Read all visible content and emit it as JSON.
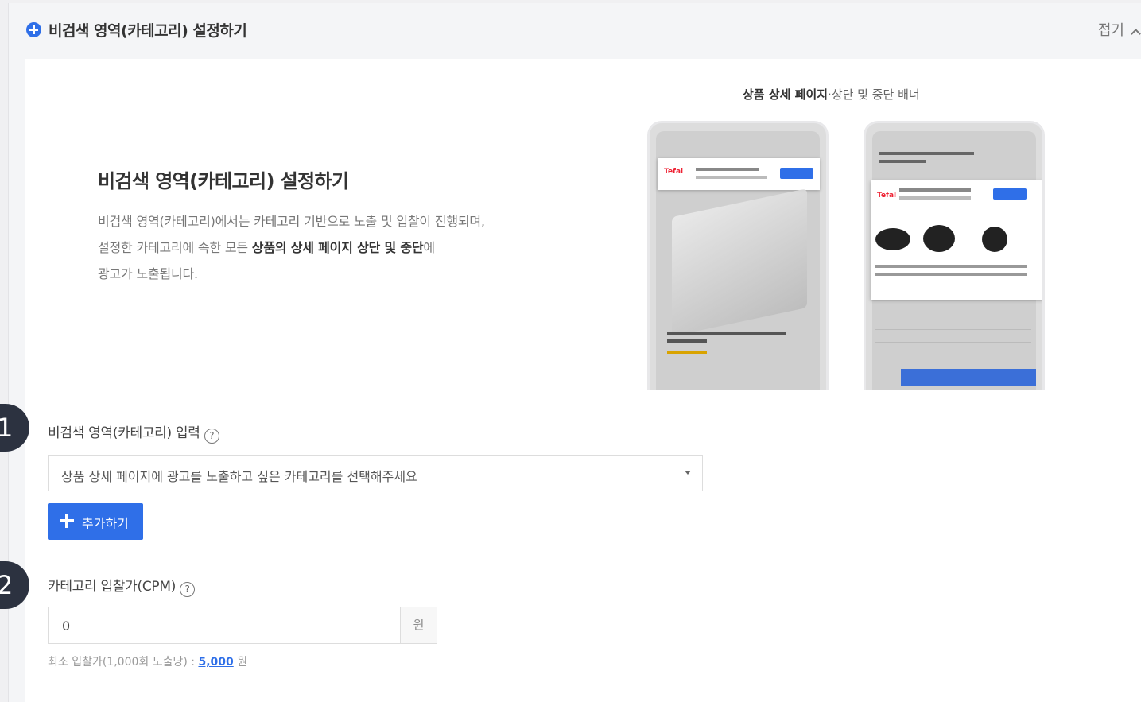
{
  "header": {
    "title": "비검색 영역(카테고리) 설정하기",
    "collapse_label": "접기"
  },
  "intro": {
    "title": "비검색 영역(카테고리) 설정하기",
    "line1": "비검색 영역(카테고리)에서는 카테고리 기반으로 노출 및 입찰이 진행되며,",
    "line2_prefix": "설정한 카테고리에 속한 모든 ",
    "line2_bold": "상품의 상세 페이지 상단 및 중단",
    "line2_suffix": "에",
    "line3": "광고가 노출됩니다."
  },
  "preview": {
    "caption_bold": "상품 상세 페이지",
    "caption_rest": "·상단 및 중단 배너",
    "brand": "Tefal"
  },
  "steps": {
    "step1_number": "1",
    "step2_number": "2"
  },
  "category": {
    "label": "비검색 영역(카테고리) 입력",
    "help": "?",
    "select_placeholder": "상품 상세 페이지에 광고를 노출하고 싶은 카테고리를 선택해주세요",
    "add_button": "추가하기"
  },
  "bid": {
    "label": "카테고리 입찰가(CPM)",
    "help": "?",
    "value": "0",
    "unit": "원",
    "hint_prefix": "최소 입찰가(1,000회 노출당) : ",
    "hint_value": "5,000",
    "hint_suffix": " 원"
  },
  "colors": {
    "accent": "#2f6fe8",
    "badge": "#2c3240"
  },
  "icons": {
    "header": "plus-circle-icon",
    "collapse": "chevron-up-icon",
    "help": "question-circle-icon",
    "select": "caret-down-icon",
    "add": "plus-icon"
  }
}
